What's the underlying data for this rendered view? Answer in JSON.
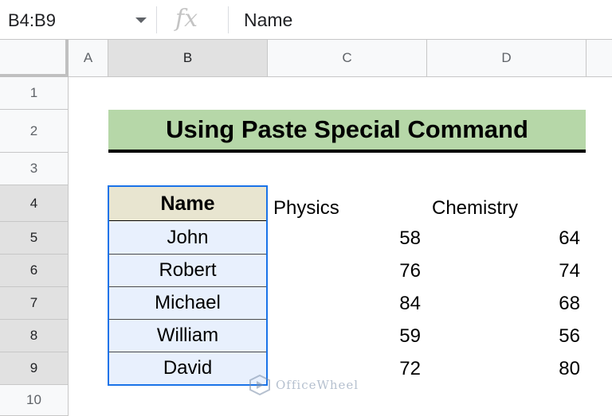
{
  "formula_bar": {
    "name_box": "B4:B9",
    "formula": "Name"
  },
  "columns": [
    "A",
    "B",
    "C",
    "D"
  ],
  "rows": [
    "1",
    "2",
    "3",
    "4",
    "5",
    "6",
    "7",
    "8",
    "9",
    "10"
  ],
  "sheet": {
    "title": "Using Paste Special Command",
    "headers": {
      "name": "Name",
      "physics": "Physics",
      "chemistry": "Chemistry"
    },
    "records": [
      {
        "name": "John",
        "physics": "58",
        "chemistry": "64"
      },
      {
        "name": "Robert",
        "physics": "76",
        "chemistry": "74"
      },
      {
        "name": "Michael",
        "physics": "84",
        "chemistry": "68"
      },
      {
        "name": "William",
        "physics": "59",
        "chemistry": "56"
      },
      {
        "name": "David",
        "physics": "72",
        "chemistry": "80"
      }
    ]
  },
  "watermark": {
    "text": "OfficeWheel"
  },
  "colors": {
    "title_fill": "#b6d7a8",
    "header_fill": "#e8e5d0",
    "selection": "#1a73e8",
    "selected_fill": "#e8f0fd"
  }
}
